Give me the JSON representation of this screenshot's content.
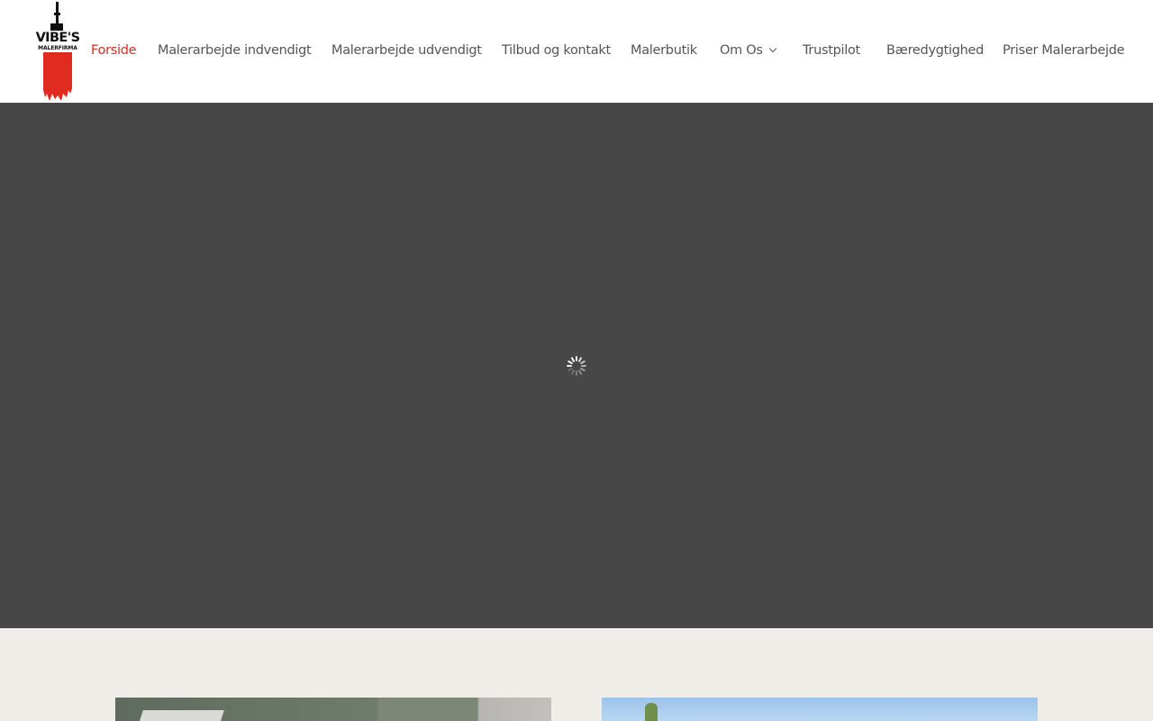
{
  "brand": {
    "logo_name": "VIBE'S",
    "logo_sub": "MALERFIRMA",
    "accent_color": "#e02b20",
    "logo_icon": "paint-roller-icon"
  },
  "nav": {
    "items": [
      {
        "label": "Forside",
        "active": true
      },
      {
        "label": "Malerarbejde indvendigt"
      },
      {
        "label": "Malerarbejde udvendigt"
      },
      {
        "label": "Tilbud og kontakt"
      },
      {
        "label": "Malerbutik"
      },
      {
        "label": "Om Os",
        "has_dropdown": true
      },
      {
        "label": "Trustpilot"
      },
      {
        "label": "Bæredygtighed"
      },
      {
        "label": "Priser Malerarbejde"
      }
    ]
  },
  "hero": {
    "background_color": "#474747",
    "state_icon": "loading-spinner-icon"
  },
  "section": {
    "background_color": "#f0ece8"
  }
}
